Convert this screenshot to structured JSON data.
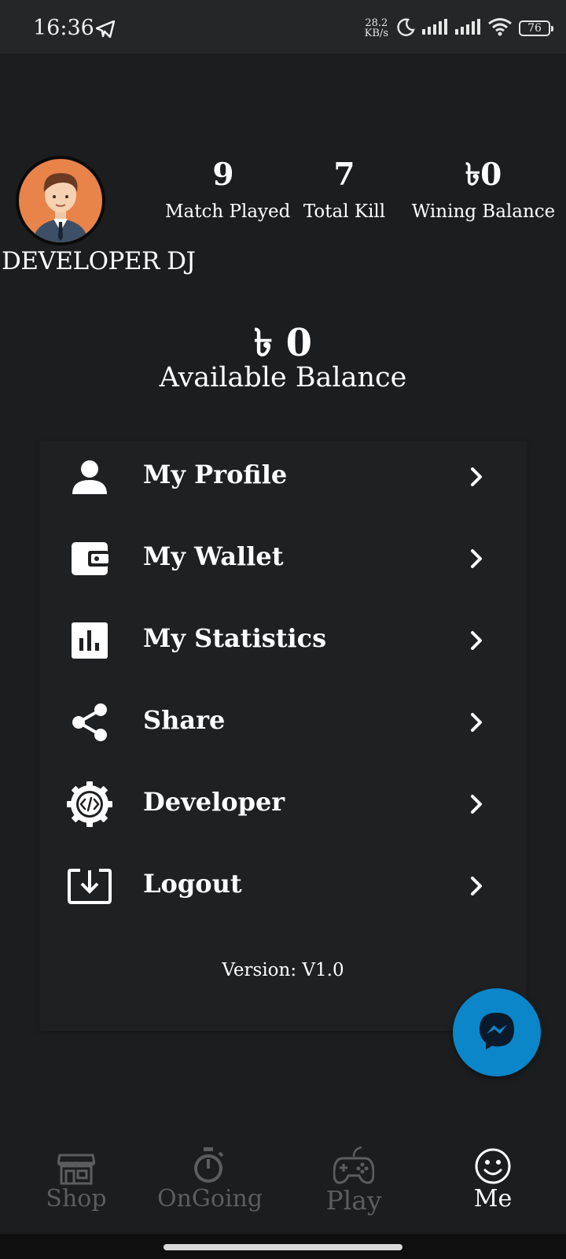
{
  "status_bar": {
    "time": "16:36",
    "speed_value": "28.2",
    "speed_unit": "KB/s",
    "battery": "76"
  },
  "profile": {
    "username": "DEVELOPER  DJ"
  },
  "stats": [
    {
      "value": "9",
      "label": "Match Played"
    },
    {
      "value": "7",
      "label": "Total Kill"
    },
    {
      "value": "৳0",
      "label": "Wining Balance"
    }
  ],
  "balance": {
    "amount": "৳ 0",
    "label": "Available Balance"
  },
  "menu": {
    "items": [
      {
        "label": "My Profile",
        "icon": "person-icon"
      },
      {
        "label": "My Wallet",
        "icon": "wallet-icon"
      },
      {
        "label": "My Statistics",
        "icon": "bar-chart-icon"
      },
      {
        "label": "Share",
        "icon": "share-icon"
      },
      {
        "label": "Developer",
        "icon": "code-gear-icon"
      },
      {
        "label": "Logout",
        "icon": "download-box-icon"
      }
    ],
    "version": "Version: V1.0"
  },
  "bottom_nav": {
    "items": [
      {
        "label": "Shop",
        "icon": "store-icon",
        "active": false
      },
      {
        "label": "OnGoing",
        "icon": "stopwatch-icon",
        "active": false
      },
      {
        "label": "Play",
        "icon": "gamepad-icon",
        "active": false
      },
      {
        "label": "Me",
        "icon": "smiley-icon",
        "active": true
      }
    ]
  },
  "colors": {
    "background": "#1c1d1f",
    "card": "#1f2022",
    "fab": "#0a86c9",
    "inactive_nav": "#5c5d5f",
    "avatar_bg": "#e8834a"
  }
}
